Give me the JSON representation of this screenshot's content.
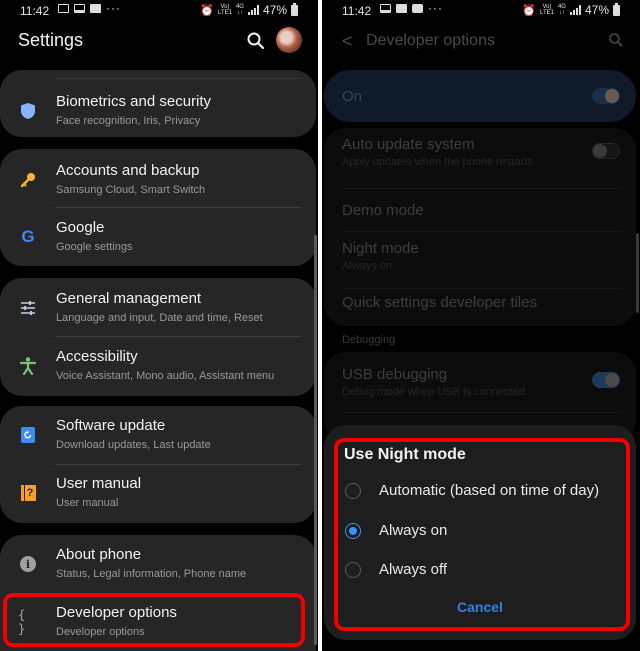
{
  "left_screen": {
    "status_bar": {
      "time": "11:42",
      "battery": "47%",
      "notification_icons": [
        "gallery-icon",
        "laptop-icon",
        "hd-icon",
        "more-icon"
      ],
      "right_icons": [
        "alarm-icon",
        "volte-icon",
        "4g-icon",
        "signal-icon",
        "battery-icon"
      ],
      "volte_label": "Vo))\nLTE1",
      "net_label": "4G\n↓↑"
    },
    "header": {
      "title": "Settings"
    },
    "cards": [
      {
        "items": [
          {
            "icon": "shield-icon",
            "title": "Biometrics and security",
            "subtitle": "Face recognition, Iris, Privacy",
            "icon_color": "#8ab4f8"
          }
        ]
      },
      {
        "items": [
          {
            "icon": "key-icon",
            "title": "Accounts and backup",
            "subtitle": "Samsung Cloud, Smart Switch",
            "icon_color": "#f5b731"
          },
          {
            "icon": "google-icon",
            "title": "Google",
            "subtitle": "Google settings",
            "icon_color": "#4285f4"
          }
        ]
      },
      {
        "items": [
          {
            "icon": "sliders-icon",
            "title": "General management",
            "subtitle": "Language and input, Date and time, Reset",
            "icon_color": "#b8c8d8"
          },
          {
            "icon": "accessibility-icon",
            "title": "Accessibility",
            "subtitle": "Voice Assistant, Mono audio, Assistant menu",
            "icon_color": "#7cc576"
          }
        ]
      },
      {
        "items": [
          {
            "icon": "software-update-icon",
            "title": "Software update",
            "subtitle": "Download updates, Last update",
            "icon_color": "#3d8ef0"
          },
          {
            "icon": "user-manual-icon",
            "title": "User manual",
            "subtitle": "User manual",
            "icon_color": "#f5a02a"
          }
        ]
      },
      {
        "items": [
          {
            "icon": "info-icon",
            "title": "About phone",
            "subtitle": "Status, Legal information, Phone name",
            "icon_color": "#9a9a9a"
          },
          {
            "icon": "braces-icon",
            "title": "Developer options",
            "subtitle": "Developer options",
            "icon_color": "#9a9a9a",
            "highlighted": true
          }
        ]
      }
    ],
    "braces_glyph": "{ }",
    "help_glyph": "?",
    "google_glyph": "G",
    "info_glyph": "i"
  },
  "right_screen": {
    "status_bar": {
      "time": "11:42",
      "battery": "47%",
      "notification_icons": [
        "laptop-icon",
        "hd-icon",
        "chat-icon",
        "more-icon"
      ]
    },
    "header": {
      "back_glyph": "<",
      "title": "Developer options"
    },
    "master_switch": {
      "label": "On",
      "enabled": true
    },
    "items": [
      {
        "title": "Auto update system",
        "subtitle": "Apply updates when the phone restarts.",
        "toggle": false
      },
      {
        "title": "Demo mode",
        "subtitle": ""
      },
      {
        "title": "Night mode",
        "subtitle": "Always on"
      },
      {
        "title": "Quick settings developer tiles",
        "subtitle": ""
      }
    ],
    "section_debugging": "Debugging",
    "usb_debugging": {
      "title": "USB debugging",
      "subtitle": "Debug mode when USB is connected",
      "toggle": true
    },
    "dialog": {
      "title": "Use Night mode",
      "options": [
        {
          "label": "Automatic (based on time of day)",
          "selected": false
        },
        {
          "label": "Always on",
          "selected": true
        },
        {
          "label": "Always off",
          "selected": false
        }
      ],
      "cancel_label": "Cancel"
    }
  },
  "colors": {
    "highlight": "#f20000",
    "accent_blue": "#3e91f5",
    "card_bg": "#262626"
  }
}
